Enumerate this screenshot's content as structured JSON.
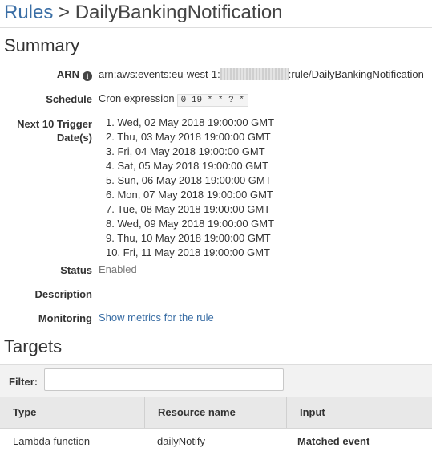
{
  "breadcrumb": {
    "parent": "Rules",
    "separator": ">",
    "current": "DailyBankingNotification"
  },
  "summary": {
    "heading": "Summary",
    "arn_label": "ARN",
    "arn_prefix": "arn:aws:events:eu-west-1:",
    "arn_suffix": ":rule/DailyBankingNotification",
    "schedule_label": "Schedule",
    "schedule_type": "Cron expression",
    "schedule_expression": "0 19 * * ? *",
    "next_label_line1": "Next 10 Trigger",
    "next_label_line2": "Date(s)",
    "next_dates": [
      "1. Wed, 02 May 2018 19:00:00 GMT",
      "2. Thu, 03 May 2018 19:00:00 GMT",
      "3. Fri, 04 May 2018 19:00:00 GMT",
      "4. Sat, 05 May 2018 19:00:00 GMT",
      "5. Sun, 06 May 2018 19:00:00 GMT",
      "6. Mon, 07 May 2018 19:00:00 GMT",
      "7. Tue, 08 May 2018 19:00:00 GMT",
      "8. Wed, 09 May 2018 19:00:00 GMT",
      "9. Thu, 10 May 2018 19:00:00 GMT",
      "10. Fri, 11 May 2018 19:00:00 GMT"
    ],
    "status_label": "Status",
    "status_value": "Enabled",
    "description_label": "Description",
    "monitoring_label": "Monitoring",
    "monitoring_link": "Show metrics for the rule"
  },
  "targets": {
    "heading": "Targets",
    "filter_label": "Filter:",
    "filter_value": "",
    "columns": [
      "Type",
      "Resource name",
      "Input"
    ],
    "rows": [
      {
        "type": "Lambda function",
        "resource_name": "dailyNotify",
        "input": "Matched event"
      }
    ]
  },
  "colors": {
    "link": "#3a6ea5",
    "status_muted": "#7a7a7a",
    "header_bg": "#e8e8e8"
  },
  "icons": {
    "arn_info": "info-icon"
  }
}
